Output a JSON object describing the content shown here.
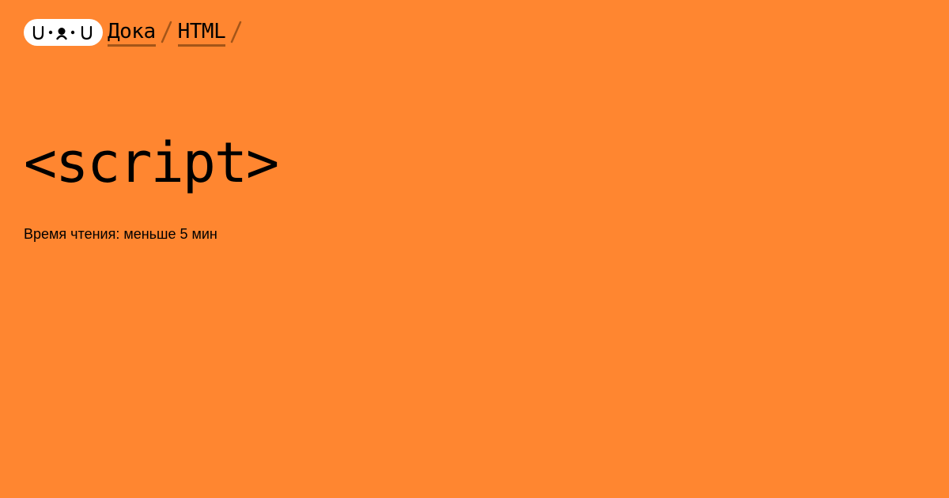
{
  "logo": {
    "icon": "doka-face-logo",
    "text": "U•ᴥ•U"
  },
  "breadcrumbs": [
    {
      "label": "Дока"
    },
    {
      "label": "HTML"
    }
  ],
  "page": {
    "title": "<script>",
    "reading_time": "Время чтения: меньше 5 мин"
  },
  "colors": {
    "background": "#ff8630",
    "text": "#000000",
    "crumb_underline": "#a45518",
    "separator": "#a45518",
    "logo_background": "#ffffff"
  }
}
